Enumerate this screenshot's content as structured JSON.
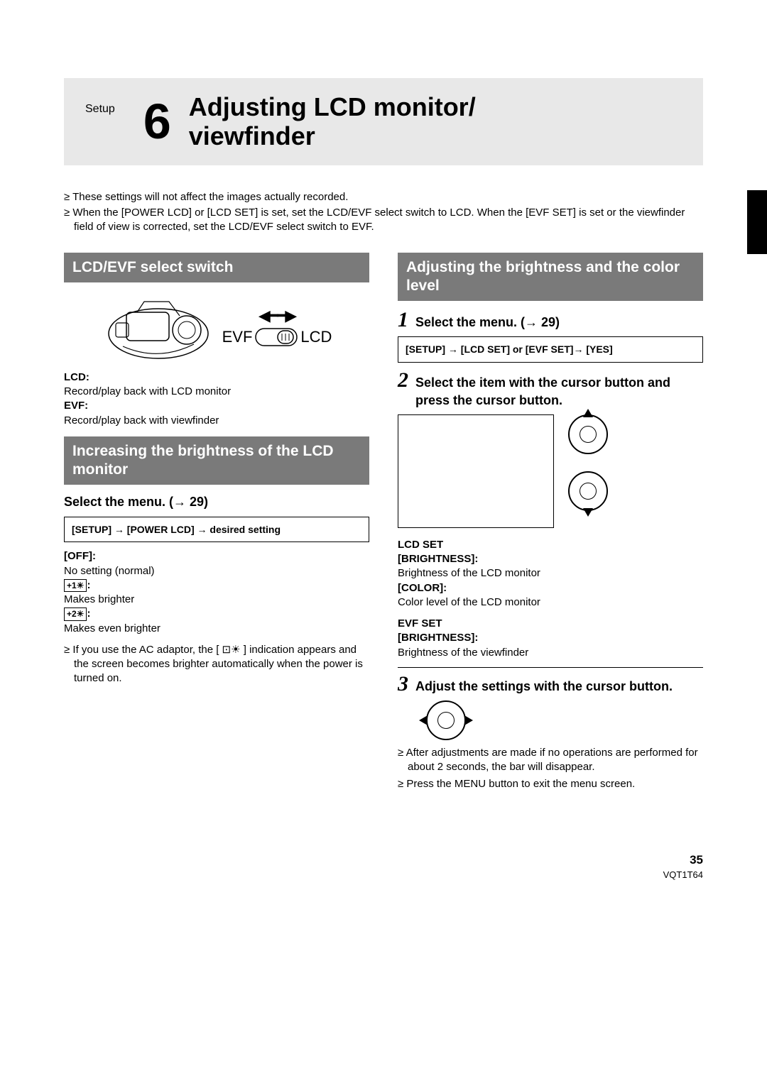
{
  "header": {
    "setup_label": "Setup",
    "number": "6",
    "title": "Adjusting LCD monitor/\nviewfinder"
  },
  "intro_bullets": [
    "These settings will not affect the images actually recorded.",
    "When the [POWER LCD] or [LCD SET] is set, set the LCD/EVF select switch to LCD. When the [EVF SET] is set or the viewfinder field of view is corrected, set the LCD/EVF select switch to EVF."
  ],
  "left": {
    "sec1_title": "LCD/EVF select switch",
    "switch_left": "EVF",
    "switch_right": "LCD",
    "lcd_label": "LCD:",
    "lcd_desc": "Record/play back with LCD monitor",
    "evf_label": "EVF:",
    "evf_desc": "Record/play back with viewfinder",
    "sec2_title": "Increasing the brightness of the LCD monitor",
    "select_menu": "Select the menu. (→ 29)",
    "menu_path": "[SETUP] → [POWER LCD] → desired setting",
    "off_label": "[OFF]:",
    "off_desc": "No setting (normal)",
    "bright1_desc": "Makes brighter",
    "bright2_desc": "Makes even brighter",
    "ac_note": "If you use the AC adaptor, the [ ⊡☀ ] indication appears and the screen becomes brighter automatically when the power is turned on."
  },
  "right": {
    "sec1_title": "Adjusting the brightness and the color level",
    "step1": "Select the menu. (→ 29)",
    "menu_path": "[SETUP] → [LCD SET] or [EVF SET]→ [YES]",
    "step2": "Select the item with the cursor button and press the cursor button.",
    "lcdset_heading": "LCD SET",
    "brightness_label": "[BRIGHTNESS]:",
    "brightness_desc": "Brightness of the LCD monitor",
    "color_label": "[COLOR]:",
    "color_desc": "Color level of the LCD monitor",
    "evfset_heading": "EVF SET",
    "evf_brightness_label": "[BRIGHTNESS]:",
    "evf_brightness_desc": "Brightness of the viewfinder",
    "step3": "Adjust the settings with the cursor button.",
    "notes": [
      "After adjustments are made if no operations are performed for about 2 seconds, the bar will disappear.",
      "Press the MENU button to exit the menu screen."
    ]
  },
  "footer": {
    "page": "35",
    "doc_code": "VQT1T64"
  }
}
